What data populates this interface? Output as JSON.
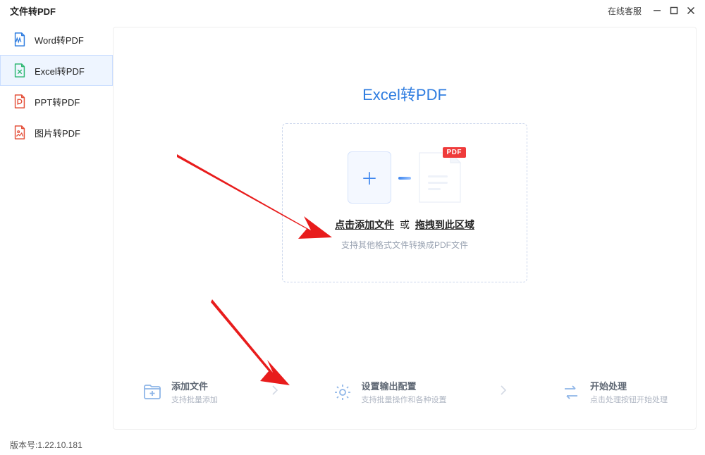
{
  "titlebar": {
    "title": "文件转PDF",
    "support": "在线客服"
  },
  "sidebar": {
    "items": [
      {
        "label": "Word转PDF"
      },
      {
        "label": "Excel转PDF"
      },
      {
        "label": "PPT转PDF"
      },
      {
        "label": "图片转PDF"
      }
    ]
  },
  "main": {
    "heading": "Excel转PDF",
    "dropzone": {
      "click_text": "点击添加文件",
      "or": "或",
      "drag_text": "拖拽到此区域",
      "subtitle": "支持其他格式文件转换成PDF文件",
      "badge": "PDF"
    }
  },
  "steps": [
    {
      "title": "添加文件",
      "subtitle": "支持批量添加"
    },
    {
      "title": "设置输出配置",
      "subtitle": "支持批量操作和各种设置"
    },
    {
      "title": "开始处理",
      "subtitle": "点击处理按钮开始处理"
    }
  ],
  "footer": {
    "version_label": "版本号:",
    "version": "1.22.10.181"
  }
}
